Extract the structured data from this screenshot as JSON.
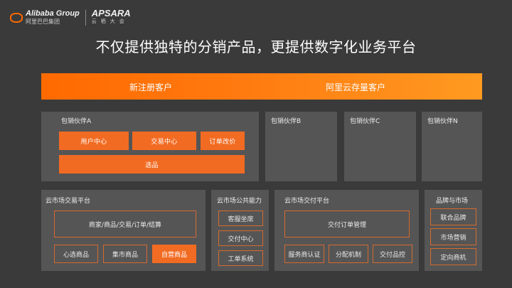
{
  "header": {
    "brand_en": "Alibaba Group",
    "brand_cn": "阿里巴巴集团",
    "apsara_en": "APSARA",
    "apsara_cn": "云栖大会"
  },
  "title": "不仅提供独特的分销产品，更提供数字化业务平台",
  "banner": {
    "left_label": "新注册客户",
    "right_label": "阿里云存量客户"
  },
  "partners": {
    "a": {
      "label": "包销伙伴A",
      "boxes": [
        "用户中心",
        "交易中心",
        "订单改价"
      ],
      "wide_box": "选品"
    },
    "b": {
      "label": "包销伙伴B"
    },
    "c": {
      "label": "包销伙伴C"
    },
    "n": {
      "label": "包销伙伴N"
    }
  },
  "market_trade": {
    "label": "云市场交易平台",
    "wide_box": "商家/商品/交易/订单/结算",
    "boxes": [
      "心选商品",
      "集市商品",
      "自营商品"
    ]
  },
  "market_public": {
    "label": "云市场公共能力",
    "boxes": [
      "客服坐席",
      "交付中心",
      "工单系统"
    ]
  },
  "market_delivery": {
    "label": "云市场交付平台",
    "wide_box": "交付订单管理",
    "boxes": [
      "服务商认证",
      "分配机制",
      "交付品控"
    ]
  },
  "brand_market": {
    "label": "品牌与市场",
    "boxes": [
      "联合品牌",
      "市场营销",
      "定向商机"
    ]
  },
  "colors": {
    "background": "#3a3a3a",
    "panel": "#555555",
    "accent": "#f26b22"
  }
}
